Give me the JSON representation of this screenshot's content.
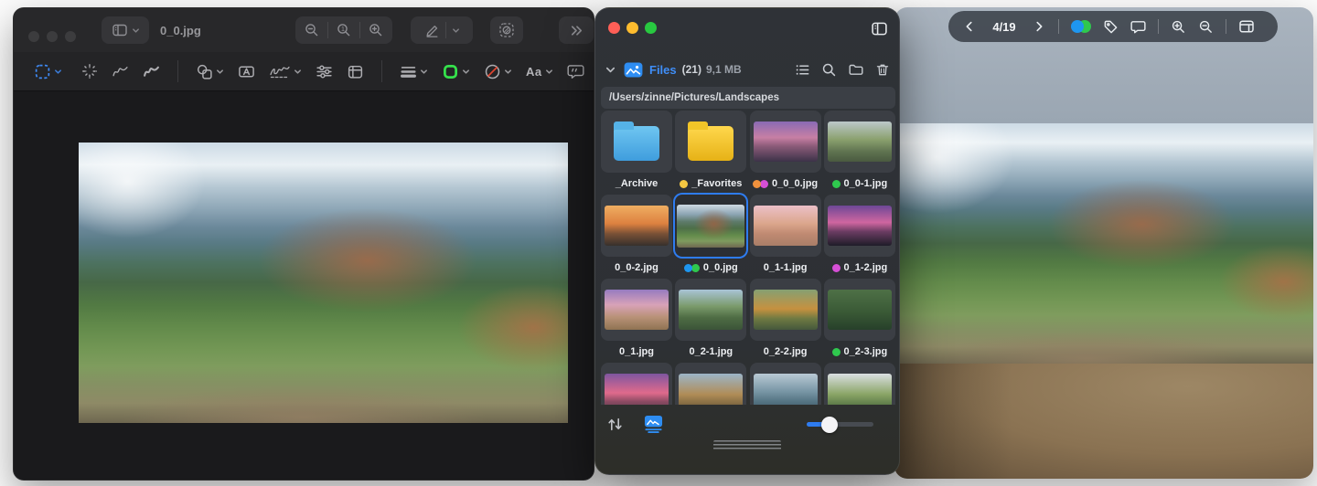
{
  "preview_window": {
    "title": "0_0.jpg",
    "titlebar_icons": [
      "sidebar-toggle",
      "zoom-out",
      "zoom-actual-size",
      "zoom-in",
      "markup-pencil",
      "adjust-filter",
      "more-toolbar-items"
    ],
    "markup_icons": [
      "selection",
      "instant-alpha",
      "sketch",
      "draw",
      "shapes",
      "text-box",
      "signature",
      "adjust-sliders",
      "crop",
      "line-weight",
      "border-color",
      "fill-color",
      "text-style",
      "quote-bubble"
    ],
    "text_style_label": "Aa",
    "selection_accent": "#3f8af5",
    "border_color_swatch": "#35e14b",
    "fill_color_slash": "#e0452f"
  },
  "files_panel": {
    "traffic_lights": [
      "#ff5f57",
      "#febc2e",
      "#28c840"
    ],
    "header": {
      "title": "Files",
      "count": "(21)",
      "size": "9,1 MB",
      "title_color": "#3f8ef7",
      "action_icons": [
        "list-view",
        "search",
        "new-folder",
        "trash"
      ]
    },
    "path": "/Users/zinne/Pictures/Landscapes",
    "items": [
      {
        "label": "_Archive",
        "type": "folder",
        "variant": "blue",
        "tags": []
      },
      {
        "label": "_Favorites",
        "type": "folder",
        "variant": "yellow",
        "tags": [
          "yellow"
        ]
      },
      {
        "label": "0_0_0.jpg",
        "type": "image",
        "thumb": "purple-rocks",
        "tags": [
          "orange",
          "magenta"
        ]
      },
      {
        "label": "0_0-1.jpg",
        "type": "image",
        "thumb": "river-valley",
        "tags": [
          "green"
        ]
      },
      {
        "label": "0_0-2.jpg",
        "type": "image",
        "thumb": "orange-sunset",
        "tags": []
      },
      {
        "label": "0_0.jpg",
        "type": "image",
        "thumb": "mountain",
        "tags": [
          "blue",
          "green"
        ],
        "selected": true
      },
      {
        "label": "0_1-1.jpg",
        "type": "image",
        "thumb": "pink-coast",
        "tags": []
      },
      {
        "label": "0_1-2.jpg",
        "type": "image",
        "thumb": "purple-trees",
        "tags": [
          "magenta"
        ]
      },
      {
        "label": "0_1.jpg",
        "type": "image",
        "thumb": "purple-field",
        "tags": []
      },
      {
        "label": "0_2-1.jpg",
        "type": "image",
        "thumb": "green-mountains",
        "tags": []
      },
      {
        "label": "0_2-2.jpg",
        "type": "image",
        "thumb": "autumn-lake",
        "tags": []
      },
      {
        "label": "0_2-3.jpg",
        "type": "image",
        "thumb": "forest",
        "tags": [
          "green"
        ]
      },
      {
        "label": "",
        "type": "image",
        "thumb": "pink-lake",
        "tags": []
      },
      {
        "label": "",
        "type": "image",
        "thumb": "valley-cliffs",
        "tags": []
      },
      {
        "label": "",
        "type": "image",
        "thumb": "lake-reflection",
        "tags": []
      },
      {
        "label": "",
        "type": "image",
        "thumb": "alpine-clouds",
        "tags": []
      }
    ],
    "footer": {
      "icons": [
        "sort",
        "gallery-view"
      ],
      "thumbnail_size_slider_pct": 34
    }
  },
  "viewer_window": {
    "nav": {
      "position": "4/19"
    },
    "toolbar_icons": [
      "previous",
      "next",
      "tag-dots",
      "tag",
      "comment-bubble",
      "zoom-in",
      "zoom-out",
      "panel-toggle"
    ],
    "tag_dots": [
      "#1e96f0",
      "#2fc84e"
    ]
  },
  "colors": {
    "tags": {
      "yellow": "#f5c842",
      "orange": "#f0913d",
      "magenta": "#d64fd6",
      "green": "#2fc84e",
      "blue": "#1e96f0"
    },
    "selection_ring": "#2e7cf0"
  }
}
